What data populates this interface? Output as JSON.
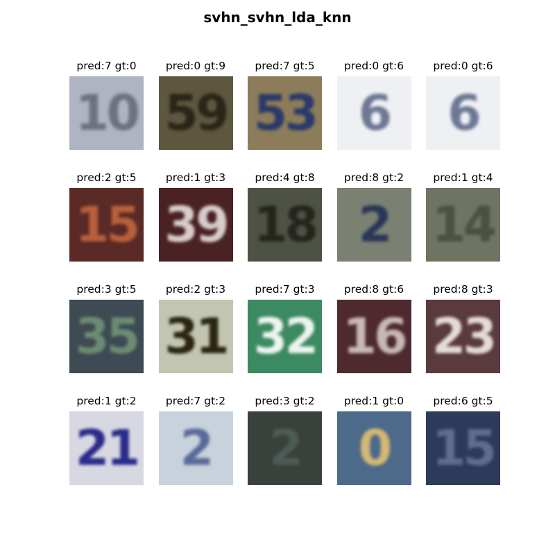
{
  "title": "svhn_svhn_lda_knn",
  "images": [
    {
      "caption": "pred:7 gt:0",
      "bg": "#aeb4c1",
      "fg": "#6c7280",
      "text": "10",
      "icon": "house-number-image"
    },
    {
      "caption": "pred:0 gt:9",
      "bg": "#5e5740",
      "fg": "#2a2518",
      "text": "59",
      "icon": "house-number-image"
    },
    {
      "caption": "pred:7 gt:5",
      "bg": "#8d7c5a",
      "fg": "#2a3a6a",
      "text": "53",
      "icon": "house-number-image"
    },
    {
      "caption": "pred:0 gt:6",
      "bg": "#eef0f4",
      "fg": "#6e7894",
      "text": "6",
      "icon": "house-number-image"
    },
    {
      "caption": "pred:0 gt:6",
      "bg": "#eef0f4",
      "fg": "#6e7894",
      "text": "6",
      "icon": "house-number-image"
    },
    {
      "caption": "pred:2 gt:5",
      "bg": "#5a2a26",
      "fg": "#b8603c",
      "text": "15",
      "icon": "house-number-image"
    },
    {
      "caption": "pred:1 gt:3",
      "bg": "#4a2224",
      "fg": "#d8cccc",
      "text": "39",
      "icon": "house-number-image"
    },
    {
      "caption": "pred:4 gt:8",
      "bg": "#4e5244",
      "fg": "#24261e",
      "text": "18",
      "icon": "house-number-image"
    },
    {
      "caption": "pred:8 gt:2",
      "bg": "#7a8072",
      "fg": "#2a3658",
      "text": "2",
      "icon": "house-number-image"
    },
    {
      "caption": "pred:1 gt:4",
      "bg": "#6e7462",
      "fg": "#4a5042",
      "text": "14",
      "icon": "house-number-image"
    },
    {
      "caption": "pred:3 gt:5",
      "bg": "#3e4a54",
      "fg": "#6c8c72",
      "text": "35",
      "icon": "house-number-image"
    },
    {
      "caption": "pred:2 gt:3",
      "bg": "#c2c6b0",
      "fg": "#2a2410",
      "text": "31",
      "icon": "house-number-image"
    },
    {
      "caption": "pred:7 gt:3",
      "bg": "#3c8a62",
      "fg": "#eef4f0",
      "text": "32",
      "icon": "house-number-image"
    },
    {
      "caption": "pred:8 gt:6",
      "bg": "#4e2a2e",
      "fg": "#c8b8b8",
      "text": "16",
      "icon": "house-number-image"
    },
    {
      "caption": "pred:8 gt:3",
      "bg": "#5a3a3e",
      "fg": "#e4dcd8",
      "text": "23",
      "icon": "house-number-image"
    },
    {
      "caption": "pred:1 gt:2",
      "bg": "#d8d8e2",
      "fg": "#2a2a8a",
      "text": "21",
      "icon": "house-number-image"
    },
    {
      "caption": "pred:7 gt:2",
      "bg": "#c8d2dc",
      "fg": "#5a6a98",
      "text": "2",
      "icon": "house-number-image"
    },
    {
      "caption": "pred:3 gt:2",
      "bg": "#3a403c",
      "fg": "#4e5c56",
      "text": "2",
      "icon": "house-number-image"
    },
    {
      "caption": "pred:1 gt:0",
      "bg": "#4e6a8a",
      "fg": "#d4b874",
      "text": "0",
      "icon": "house-number-image"
    },
    {
      "caption": "pred:6 gt:5",
      "bg": "#2e3a5a",
      "fg": "#5e6e8e",
      "text": "15",
      "icon": "house-number-image"
    }
  ]
}
